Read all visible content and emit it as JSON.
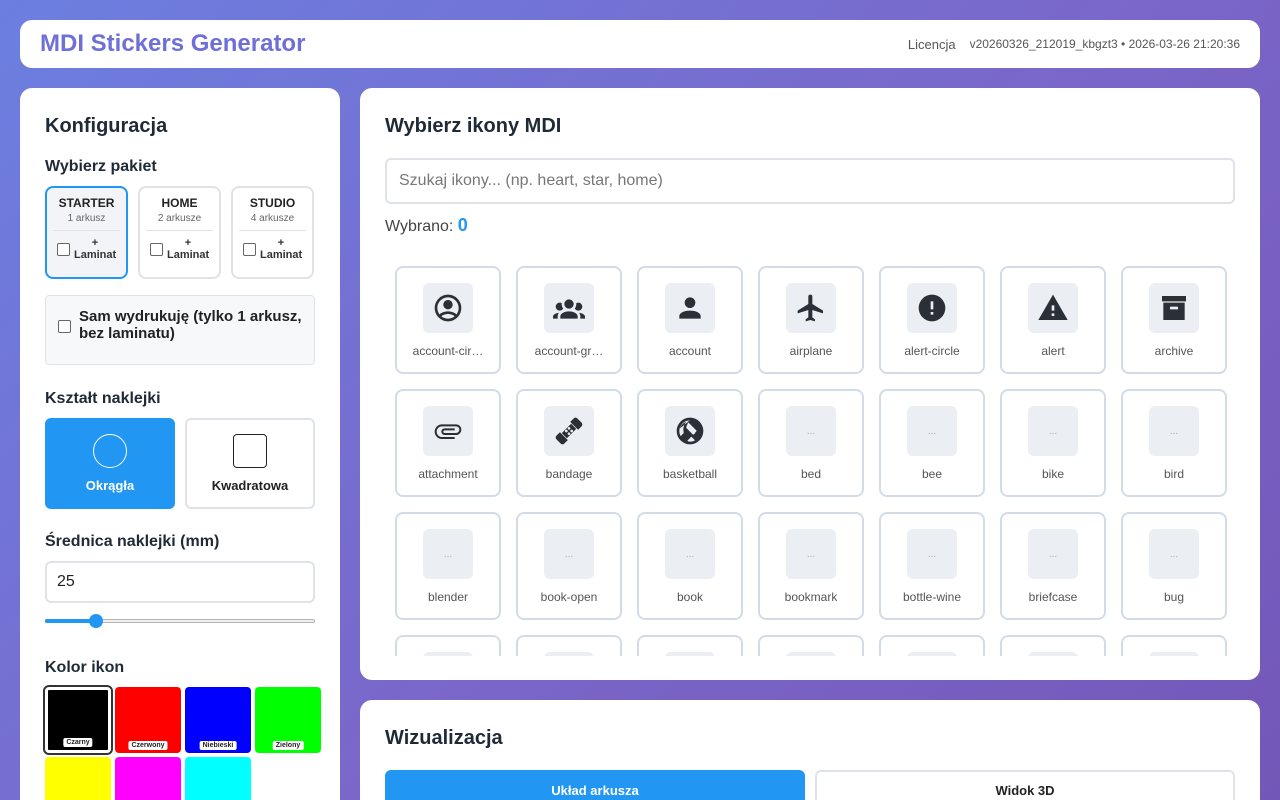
{
  "header": {
    "title": "MDI Stickers Generator",
    "license_link": "Licencja",
    "version": "v20260326_212019_kbgzt3 • 2026-03-26 21:20:36"
  },
  "config": {
    "title": "Konfiguracja",
    "package_label": "Wybierz pakiet",
    "packages": [
      {
        "name": "STARTER",
        "sheets": "1 arkusz",
        "option": "+ Laminat"
      },
      {
        "name": "HOME",
        "sheets": "2 arkusze",
        "option": "+ Laminat"
      },
      {
        "name": "STUDIO",
        "sheets": "4 arkusze",
        "option": "+ Laminat"
      }
    ],
    "selected_package": "STARTER",
    "self_print_label": "Sam wydrukuję (tylko 1 arkusz, bez laminatu)",
    "self_print_checked": false,
    "shape_label": "Kształt naklejki",
    "shapes": [
      {
        "label": "Okrągła",
        "active": true
      },
      {
        "label": "Kwadratowa",
        "active": false
      }
    ],
    "diameter_label": "Średnica naklejki (mm)",
    "diameter_value": "25",
    "slider_fraction": 0.19,
    "color_label": "Kolor ikon",
    "colors": [
      {
        "label": "Czarny",
        "hex": "#000000"
      },
      {
        "label": "Czerwony",
        "hex": "#ff0000"
      },
      {
        "label": "Niebieski",
        "hex": "#0000ff"
      },
      {
        "label": "Zielony",
        "hex": "#00ff00"
      },
      {
        "label": "",
        "hex": "#ffff00"
      },
      {
        "label": "",
        "hex": "#ff00ff"
      },
      {
        "label": "",
        "hex": "#00ffff"
      }
    ],
    "selected_color": "Czarny"
  },
  "icons": {
    "title": "Wybierz ikony MDI",
    "search_placeholder": "Szukaj ikony... (np. heart, star, home)",
    "selected_label": "Wybrano:",
    "selected_count": "0",
    "placeholder_glyph": "...",
    "items": [
      {
        "name": "account-cir…",
        "icon": "account-circle-icon"
      },
      {
        "name": "account-gr…",
        "icon": "account-group-icon"
      },
      {
        "name": "account",
        "icon": "account-icon"
      },
      {
        "name": "airplane",
        "icon": "airplane-icon"
      },
      {
        "name": "alert-circle",
        "icon": "alert-circle-icon"
      },
      {
        "name": "alert",
        "icon": "alert-icon"
      },
      {
        "name": "archive",
        "icon": "archive-icon"
      },
      {
        "name": "attachment",
        "icon": "attachment-icon"
      },
      {
        "name": "bandage",
        "icon": "bandage-icon"
      },
      {
        "name": "basketball",
        "icon": "basketball-icon"
      },
      {
        "name": "bed",
        "icon": ""
      },
      {
        "name": "bee",
        "icon": ""
      },
      {
        "name": "bike",
        "icon": ""
      },
      {
        "name": "bird",
        "icon": ""
      },
      {
        "name": "blender",
        "icon": ""
      },
      {
        "name": "book-open",
        "icon": ""
      },
      {
        "name": "book",
        "icon": ""
      },
      {
        "name": "bookmark",
        "icon": ""
      },
      {
        "name": "bottle-wine",
        "icon": ""
      },
      {
        "name": "briefcase",
        "icon": ""
      },
      {
        "name": "bug",
        "icon": ""
      },
      {
        "name": "",
        "icon": ""
      },
      {
        "name": "",
        "icon": ""
      },
      {
        "name": "",
        "icon": ""
      },
      {
        "name": "",
        "icon": ""
      },
      {
        "name": "",
        "icon": ""
      },
      {
        "name": "",
        "icon": ""
      },
      {
        "name": "",
        "icon": ""
      }
    ]
  },
  "visualization": {
    "title": "Wizualizacja",
    "tabs": [
      {
        "label": "Układ arkusza",
        "active": true
      },
      {
        "label": "Widok 3D",
        "active": false
      }
    ]
  }
}
